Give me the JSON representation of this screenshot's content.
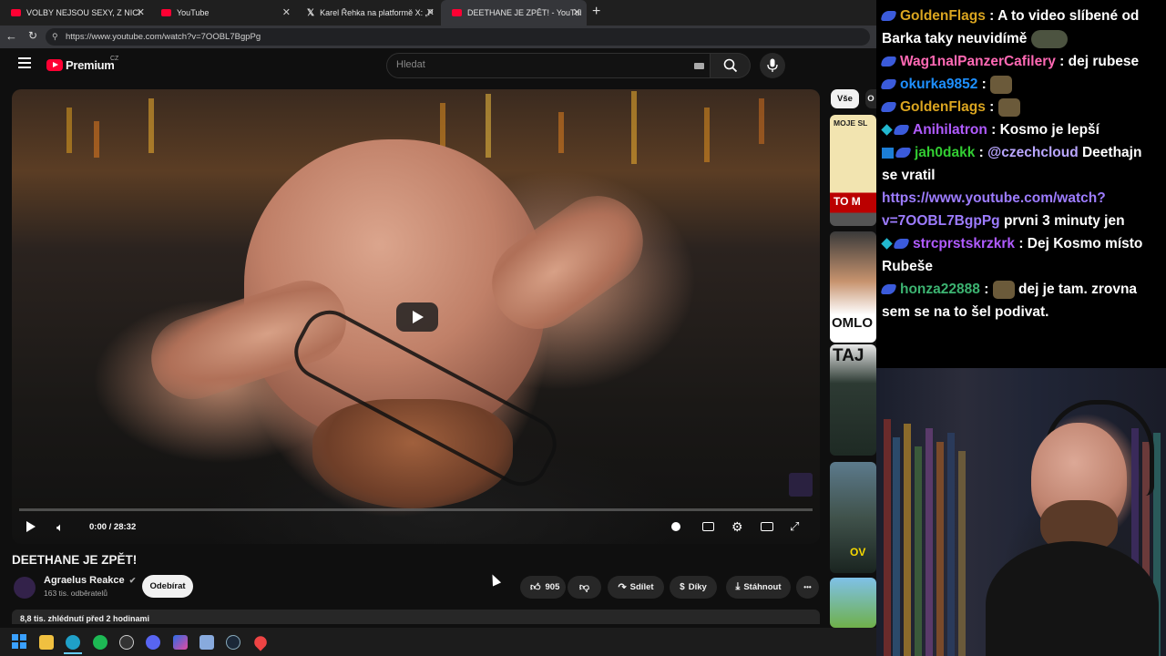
{
  "browser": {
    "tabs": [
      {
        "label": "VOLBY NEJSOU SEXY, Z NICH NEM",
        "active": false
      },
      {
        "label": "YouTube",
        "active": false
      },
      {
        "label": "Karel Řehka na platformě X: „Po vl",
        "active": false
      },
      {
        "label": "DEETHANE JE ZPĚT! - YouTube",
        "active": true
      }
    ],
    "new_tab_label": "+",
    "url": "https://www.youtube.com/watch?v=7OOBL7BgpPg"
  },
  "youtube": {
    "logo_text": "Premium",
    "region": "CZ",
    "search_placeholder": "Hledat",
    "video": {
      "title": "DEETHANE JE ZPĚT!",
      "time": "0:00 / 28:32",
      "progress": 0
    },
    "channel": {
      "name": "Agraelus Reakce",
      "subscribers": "163 tis. odběratelů",
      "subscribe_label": "Odebírat"
    },
    "actions": {
      "likes": "905",
      "share": "Sdílet",
      "thanks": "Díky",
      "download": "Stáhnout",
      "more": "•••"
    },
    "description_stats": "8,8 tis. zhlédnutí  před 2 hodinami",
    "sidebar": {
      "chip_all": "Vše",
      "chip_next": "O",
      "thumbs": [
        {
          "text": "MOJE SL",
          "sub": "TO M"
        },
        {
          "text": "OMLO"
        },
        {
          "text": "TAJ"
        },
        {
          "text": "OV"
        },
        {
          "text": ""
        }
      ]
    }
  },
  "chat": {
    "messages": [
      {
        "user": "GoldenFlags",
        "color": "#daa520",
        "badges": [
          "bits"
        ],
        "text": "A to video slíbené od Barka taky neuvidímě",
        "emote_after": true
      },
      {
        "user": "Wag1nalPanzerCafilery",
        "color": "#ff69b4",
        "badges": [
          "bits"
        ],
        "text": "dej rubese"
      },
      {
        "user": "okurka9852",
        "color": "#1e90ff",
        "badges": [
          "bits"
        ],
        "text": "",
        "emote_after": true
      },
      {
        "user": "GoldenFlags",
        "color": "#daa520",
        "badges": [
          "bits"
        ],
        "text": "",
        "emote_after": true
      },
      {
        "user": "Anihilatron",
        "color": "#b05bff",
        "badges": [
          "cube",
          "bits"
        ],
        "text": "Kosmo je lepší"
      },
      {
        "user": "jah0dakk",
        "color": "#32cd32",
        "badges": [
          "prime",
          "bits"
        ],
        "mention": "@czechcloud",
        "text": "Deethajn se vratil",
        "link": "https://www.youtube.com/watch?v=7OOBL7BgpPg",
        "text2": "prvni 3 minuty jen"
      },
      {
        "user": "strcprstskrzkrk",
        "color": "#b05bff",
        "badges": [
          "cube",
          "bits"
        ],
        "text": "Dej Kosmo místo Rubeše"
      },
      {
        "user": "honza22888",
        "color": "#3cb371",
        "badges": [
          "bits"
        ],
        "text": "dej je tam. zrovna sem se na to šel podivat.",
        "emote_before": true
      }
    ]
  },
  "colors": {
    "yt_red": "#ff0033",
    "background": "#0f0f0f",
    "chat_bg": "#000000"
  }
}
